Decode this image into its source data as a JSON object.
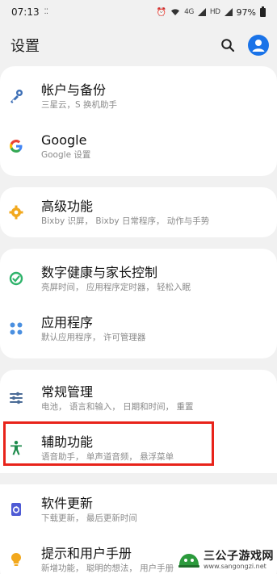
{
  "status": {
    "time": "07:13",
    "net_small": "4G",
    "net_small2": "HD",
    "battery": "97%"
  },
  "header": {
    "title": "设置",
    "search_icon": "search-icon",
    "account_icon": "account-icon"
  },
  "groups": [
    {
      "items": [
        {
          "icon": "key-icon",
          "color": "#3d6fb6",
          "title": "帐户与备份",
          "subtitle": "三星云，S 换机助手"
        },
        {
          "icon": "google-icon",
          "color": "#4285f4",
          "title": "Google",
          "subtitle": "Google 设置"
        }
      ]
    },
    {
      "items": [
        {
          "icon": "puzzle-gear-icon",
          "color": "#f2a81d",
          "title": "高级功能",
          "subtitle": "Bixby 识屏，  Bixby 日常程序，  动作与手势"
        }
      ]
    },
    {
      "items": [
        {
          "icon": "wellbeing-icon",
          "color": "#2fb36b",
          "title": "数字健康与家长控制",
          "subtitle": "亮屏时间，  应用程序定时器，  轻松入眠"
        },
        {
          "icon": "apps-icon",
          "color": "#4a8fe0",
          "title": "应用程序",
          "subtitle": "默认应用程序，  许可管理器"
        }
      ]
    },
    {
      "items": [
        {
          "icon": "sliders-icon",
          "color": "#4a6b96",
          "title": "常规管理",
          "subtitle": "电池，  语言和输入，  日期和时间，  重置"
        },
        {
          "icon": "accessibility-icon",
          "color": "#1e8b4c",
          "title": "辅助功能",
          "subtitle": "语音助手，  单声道音频，  悬浮菜单"
        },
        {
          "icon": "update-icon",
          "color": "#4f5bd5",
          "title": "软件更新",
          "subtitle": "下载更新，  最后更新时间"
        },
        {
          "icon": "bulb-icon",
          "color": "#f2a81d",
          "title": "提示和用户手册",
          "subtitle": "新增功能，  聪明的想法，  用户手册"
        }
      ]
    }
  ],
  "watermark": {
    "main": "三公子游戏网",
    "url": "www.sangongzi.net"
  },
  "colors": {
    "accent": "#1a73e8",
    "highlight": "#e8231a"
  }
}
